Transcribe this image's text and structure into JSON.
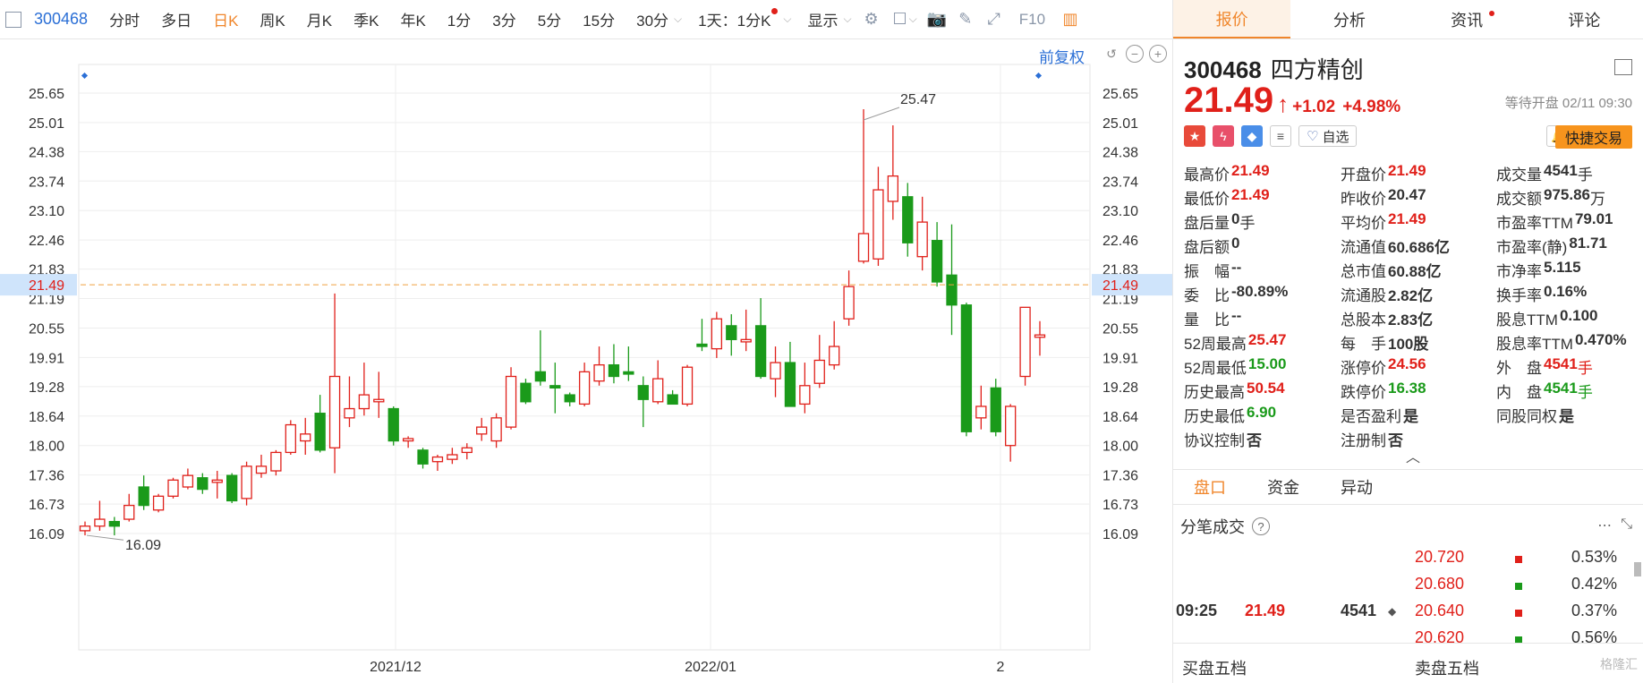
{
  "toolbar": {
    "code": "300468",
    "tabs": [
      "分时",
      "多日",
      "日K",
      "周K",
      "月K",
      "季K",
      "年K",
      "1分",
      "3分",
      "5分",
      "15分",
      "30分"
    ],
    "active": "日K",
    "period": "1天：1分K",
    "display": "显示",
    "f10": "F10"
  },
  "chart": {
    "fuquan": "前复权",
    "y_ticks": [
      "25.65",
      "25.01",
      "24.38",
      "23.74",
      "23.10",
      "22.46",
      "21.83",
      "21.19",
      "20.55",
      "19.91",
      "19.28",
      "18.64",
      "18.00",
      "17.36",
      "16.73",
      "16.09"
    ],
    "current_label": "21.49",
    "max_label": "25.47",
    "min_label": "16.09",
    "x_labels": [
      "2021/12",
      "2022/01",
      "2"
    ],
    "colors": {
      "up": "#e0201a",
      "down": "#1a9a1a",
      "grid": "#eeeeee",
      "price_line": "#f0a040"
    }
  },
  "chart_data": {
    "type": "candlestick",
    "ylim": [
      15.8,
      26.2
    ],
    "x_labels": [
      "2021/12",
      "2022/01",
      "2"
    ],
    "candles": [
      {
        "o": 16.15,
        "c": 16.25,
        "h": 16.35,
        "l": 16.05
      },
      {
        "o": 16.25,
        "c": 16.4,
        "h": 16.8,
        "l": 16.15
      },
      {
        "o": 16.35,
        "c": 16.25,
        "h": 16.45,
        "l": 16.05
      },
      {
        "o": 16.4,
        "c": 16.7,
        "h": 16.95,
        "l": 16.35
      },
      {
        "o": 17.1,
        "c": 16.7,
        "h": 17.35,
        "l": 16.6
      },
      {
        "o": 16.6,
        "c": 16.9,
        "h": 16.95,
        "l": 16.55
      },
      {
        "o": 16.9,
        "c": 17.25,
        "h": 17.3,
        "l": 16.85
      },
      {
        "o": 17.1,
        "c": 17.35,
        "h": 17.5,
        "l": 17.05
      },
      {
        "o": 17.3,
        "c": 17.05,
        "h": 17.4,
        "l": 16.95
      },
      {
        "o": 17.2,
        "c": 17.25,
        "h": 17.45,
        "l": 16.85
      },
      {
        "o": 17.35,
        "c": 16.8,
        "h": 17.4,
        "l": 16.75
      },
      {
        "o": 16.85,
        "c": 17.55,
        "h": 17.65,
        "l": 16.7
      },
      {
        "o": 17.4,
        "c": 17.55,
        "h": 17.8,
        "l": 17.3
      },
      {
        "o": 17.45,
        "c": 17.85,
        "h": 17.9,
        "l": 17.35
      },
      {
        "o": 17.85,
        "c": 18.45,
        "h": 18.55,
        "l": 17.8
      },
      {
        "o": 18.1,
        "c": 18.25,
        "h": 18.6,
        "l": 17.8
      },
      {
        "o": 18.7,
        "c": 17.9,
        "h": 19.1,
        "l": 17.85
      },
      {
        "o": 17.95,
        "c": 19.5,
        "h": 21.3,
        "l": 17.4
      },
      {
        "o": 18.6,
        "c": 18.8,
        "h": 19.5,
        "l": 18.4
      },
      {
        "o": 18.8,
        "c": 19.1,
        "h": 19.8,
        "l": 18.65
      },
      {
        "o": 18.95,
        "c": 19.0,
        "h": 19.6,
        "l": 18.6
      },
      {
        "o": 18.8,
        "c": 18.1,
        "h": 18.85,
        "l": 18.0
      },
      {
        "o": 18.1,
        "c": 18.15,
        "h": 18.2,
        "l": 17.95
      },
      {
        "o": 17.9,
        "c": 17.6,
        "h": 17.95,
        "l": 17.5
      },
      {
        "o": 17.65,
        "c": 17.75,
        "h": 17.8,
        "l": 17.45
      },
      {
        "o": 17.7,
        "c": 17.8,
        "h": 17.95,
        "l": 17.6
      },
      {
        "o": 17.85,
        "c": 17.95,
        "h": 18.05,
        "l": 17.7
      },
      {
        "o": 18.25,
        "c": 18.4,
        "h": 18.6,
        "l": 18.1
      },
      {
        "o": 18.1,
        "c": 18.6,
        "h": 18.7,
        "l": 17.95
      },
      {
        "o": 18.4,
        "c": 19.5,
        "h": 19.7,
        "l": 18.35
      },
      {
        "o": 19.35,
        "c": 18.95,
        "h": 19.45,
        "l": 18.9
      },
      {
        "o": 19.6,
        "c": 19.4,
        "h": 20.5,
        "l": 19.3
      },
      {
        "o": 19.3,
        "c": 19.25,
        "h": 19.8,
        "l": 18.7
      },
      {
        "o": 19.1,
        "c": 18.95,
        "h": 19.15,
        "l": 18.85
      },
      {
        "o": 18.9,
        "c": 19.6,
        "h": 19.8,
        "l": 18.85
      },
      {
        "o": 19.4,
        "c": 19.75,
        "h": 20.15,
        "l": 19.3
      },
      {
        "o": 19.75,
        "c": 19.5,
        "h": 20.2,
        "l": 19.35
      },
      {
        "o": 19.6,
        "c": 19.55,
        "h": 20.15,
        "l": 19.4
      },
      {
        "o": 19.3,
        "c": 19.0,
        "h": 19.5,
        "l": 18.4
      },
      {
        "o": 18.95,
        "c": 19.45,
        "h": 19.85,
        "l": 18.9
      },
      {
        "o": 19.1,
        "c": 18.9,
        "h": 19.2,
        "l": 18.9
      },
      {
        "o": 18.9,
        "c": 19.7,
        "h": 19.75,
        "l": 18.85
      },
      {
        "o": 20.2,
        "c": 20.15,
        "h": 20.75,
        "l": 20.05
      },
      {
        "o": 20.1,
        "c": 20.75,
        "h": 20.9,
        "l": 19.9
      },
      {
        "o": 20.6,
        "c": 20.3,
        "h": 20.85,
        "l": 19.95
      },
      {
        "o": 20.25,
        "c": 20.3,
        "h": 20.95,
        "l": 20.05
      },
      {
        "o": 20.6,
        "c": 19.5,
        "h": 21.2,
        "l": 19.45
      },
      {
        "o": 19.45,
        "c": 19.8,
        "h": 20.15,
        "l": 19.05
      },
      {
        "o": 19.8,
        "c": 18.85,
        "h": 20.25,
        "l": 18.85
      },
      {
        "o": 18.9,
        "c": 19.3,
        "h": 19.8,
        "l": 18.7
      },
      {
        "o": 19.35,
        "c": 19.85,
        "h": 20.4,
        "l": 19.25
      },
      {
        "o": 19.75,
        "c": 20.15,
        "h": 20.7,
        "l": 19.65
      },
      {
        "o": 20.75,
        "c": 21.45,
        "h": 21.8,
        "l": 20.6
      },
      {
        "o": 22.0,
        "c": 22.6,
        "h": 25.3,
        "l": 21.95
      },
      {
        "o": 22.05,
        "c": 23.55,
        "h": 24.05,
        "l": 21.9
      },
      {
        "o": 23.3,
        "c": 23.85,
        "h": 24.95,
        "l": 22.9
      },
      {
        "o": 23.4,
        "c": 22.4,
        "h": 23.7,
        "l": 22.1
      },
      {
        "o": 22.1,
        "c": 22.85,
        "h": 23.4,
        "l": 21.8
      },
      {
        "o": 22.45,
        "c": 21.55,
        "h": 22.85,
        "l": 21.45
      },
      {
        "o": 21.7,
        "c": 21.05,
        "h": 22.8,
        "l": 20.4
      },
      {
        "o": 21.05,
        "c": 18.3,
        "h": 21.1,
        "l": 18.2
      },
      {
        "o": 18.6,
        "c": 18.85,
        "h": 19.3,
        "l": 18.35
      },
      {
        "o": 19.25,
        "c": 18.3,
        "h": 19.45,
        "l": 18.2
      },
      {
        "o": 18.0,
        "c": 18.85,
        "h": 18.9,
        "l": 17.65
      },
      {
        "o": 19.5,
        "c": 21.0,
        "h": 21.0,
        "l": 19.3
      },
      {
        "o": 20.35,
        "c": 20.4,
        "h": 20.7,
        "l": 19.95
      }
    ]
  },
  "panel": {
    "tabs": [
      "报价",
      "分析",
      "资讯",
      "评论"
    ],
    "code": "300468",
    "name": "四方精创",
    "price": "21.49",
    "arrow": "↑",
    "change": "+1.02",
    "change_pct": "+4.98%",
    "status": "等待开盘 02/11 09:30",
    "zixuan": "自选",
    "trade_btn": "快捷交易",
    "quotes": [
      [
        {
          "l": "最高价",
          "v": "21.49",
          "c": "red"
        },
        {
          "l": "开盘价",
          "v": "21.49",
          "c": "red"
        },
        {
          "l": "成交量",
          "v": "4541",
          "u": "手",
          "c": "dark"
        }
      ],
      [
        {
          "l": "最低价",
          "v": "21.49",
          "c": "red"
        },
        {
          "l": "昨收价",
          "v": "20.47",
          "c": "dark"
        },
        {
          "l": "成交额",
          "v": "975.86",
          "u": "万",
          "c": "dark"
        }
      ],
      [
        {
          "l": "盘后量",
          "v": "0",
          "u": "手",
          "c": "dark"
        },
        {
          "l": "平均价",
          "v": "21.49",
          "c": "red"
        },
        {
          "l": "市盈率TTM",
          "v": "79.01",
          "c": "dark"
        }
      ],
      [
        {
          "l": "盘后额",
          "v": "0",
          "c": "dark"
        },
        {
          "l": "流通值",
          "v": "60.686亿",
          "c": "dark"
        },
        {
          "l": "市盈率(静)",
          "v": "81.71",
          "c": "dark"
        }
      ],
      [
        {
          "l": "振　幅",
          "v": "--",
          "c": "dark"
        },
        {
          "l": "总市值",
          "v": "60.88亿",
          "c": "dark"
        },
        {
          "l": "市净率",
          "v": "5.115",
          "c": "dark"
        }
      ],
      [
        {
          "l": "委　比",
          "v": "-80.89%",
          "c": "dark"
        },
        {
          "l": "流通股",
          "v": "2.82亿",
          "c": "dark"
        },
        {
          "l": "换手率",
          "v": "0.16%",
          "c": "dark"
        }
      ],
      [
        {
          "l": "量　比",
          "v": "--",
          "c": "dark"
        },
        {
          "l": "总股本",
          "v": "2.83亿",
          "c": "dark"
        },
        {
          "l": "股息TTM",
          "v": "0.100",
          "c": "dark"
        }
      ],
      [
        {
          "l": "52周最高",
          "v": "25.47",
          "c": "red"
        },
        {
          "l": "每　手",
          "v": "100股",
          "c": "dark"
        },
        {
          "l": "股息率TTM",
          "v": "0.470%",
          "c": "dark"
        }
      ],
      [
        {
          "l": "52周最低",
          "v": "15.00",
          "c": "green"
        },
        {
          "l": "涨停价",
          "v": "24.56",
          "c": "red"
        },
        {
          "l": "外　盘",
          "v": "4541",
          "u": "手",
          "c": "red"
        }
      ],
      [
        {
          "l": "历史最高",
          "v": "50.54",
          "c": "red"
        },
        {
          "l": "跌停价",
          "v": "16.38",
          "c": "green"
        },
        {
          "l": "内　盘",
          "v": "4541",
          "u": "手",
          "c": "green"
        }
      ],
      [
        {
          "l": "历史最低",
          "v": "6.90",
          "c": "green"
        },
        {
          "l": "是否盈利",
          "v": "是",
          "c": "dark"
        },
        {
          "l": "同股同权",
          "v": "是",
          "c": "dark"
        }
      ],
      [
        {
          "l": "协议控制",
          "v": "否",
          "c": "dark"
        },
        {
          "l": "注册制",
          "v": "否",
          "c": "dark"
        },
        {
          "l": "",
          "v": "",
          "c": "dark"
        }
      ]
    ],
    "subtabs": [
      "盘口",
      "资金",
      "异动"
    ],
    "fenbi_title": "分笔成交",
    "trades": [
      {
        "p": "20.720",
        "pct": "0.53%",
        "c": "#e0201a"
      },
      {
        "p": "20.680",
        "pct": "0.42%",
        "c": "#1a9a1a"
      },
      {
        "p": "20.640",
        "pct": "0.37%",
        "c": "#e0201a"
      },
      {
        "p": "20.620",
        "pct": "0.56%",
        "c": "#1a9a1a"
      }
    ],
    "main_trade": {
      "time": "09:25",
      "price": "21.49",
      "vol": "4541"
    },
    "buy5": "买盘五档",
    "sell5": "卖盘五档",
    "watermark": "格隆汇"
  }
}
